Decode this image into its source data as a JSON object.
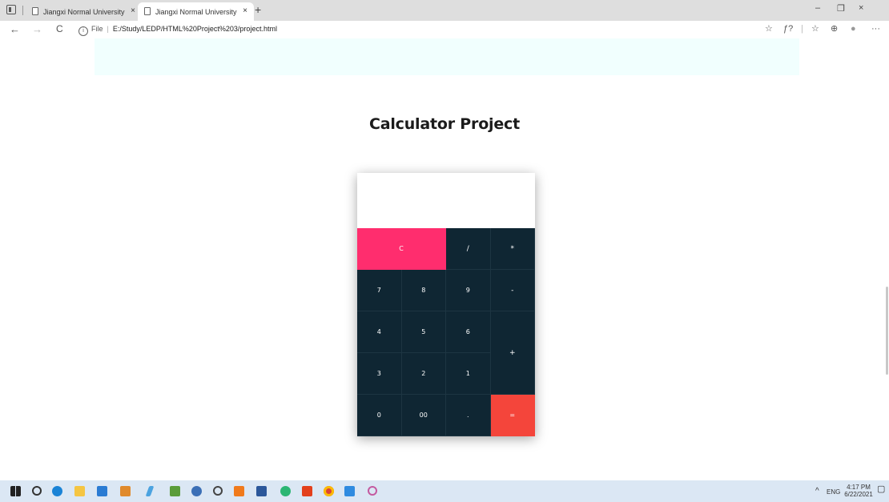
{
  "browser": {
    "tabs": [
      {
        "title": "Jiangxi Normal University",
        "close": "×",
        "active": false
      },
      {
        "title": "Jiangxi Normal University",
        "close": "×",
        "active": true
      }
    ],
    "new_tab": "+",
    "window_controls": {
      "minimize": "–",
      "restore": "❐",
      "close": "×"
    },
    "address": {
      "info_icon": "i",
      "scheme_label": "File",
      "url": "E:/Study/LEDP/HTML%20Project%203/project.html"
    },
    "nav": {
      "back": "←",
      "forward": "→",
      "refresh": "C"
    },
    "toolbar_icons": [
      "read-aloud-icon",
      "font-icon",
      "favorites-icon",
      "collections-icon",
      "profile-icon",
      "more-icon"
    ],
    "toolbar_glyphs": {
      "read": "☆",
      "font": "ƒ?",
      "fav": "☆",
      "coll": "⊕",
      "profile": "●",
      "more": "···"
    }
  },
  "page": {
    "title": "Calculator Project",
    "calculator": {
      "display_value": "",
      "keys": {
        "clear": "C",
        "divide": "/",
        "multiply": "*",
        "seven": "7",
        "eight": "8",
        "nine": "9",
        "minus": "-",
        "four": "4",
        "five": "5",
        "six": "6",
        "plus": "+",
        "three": "3",
        "two": "2",
        "one": "1",
        "zero": "0",
        "double_zero": "00",
        "dot": ".",
        "equals": "="
      },
      "colors": {
        "keypad": "#0f2633",
        "clear": "#ff2d6e",
        "equals": "#f4453b",
        "banner": "#f1fffe"
      }
    }
  },
  "taskbar": {
    "apps": [
      "windows-start-icon",
      "search-icon",
      "edge-icon",
      "file-explorer-icon",
      "store-icon",
      "sublime-icon",
      "notepad-icon",
      "paint-icon",
      "media-icon",
      "settings-icon",
      "xampp-icon",
      "word-icon",
      "app-icon",
      "office-icon",
      "chrome-icon",
      "vscode-icon",
      "paint3d-icon"
    ],
    "tray": {
      "chevron": "^",
      "language": "ENG",
      "time": "4:17 PM",
      "date": "6/22/2021",
      "notification": "▢"
    }
  }
}
